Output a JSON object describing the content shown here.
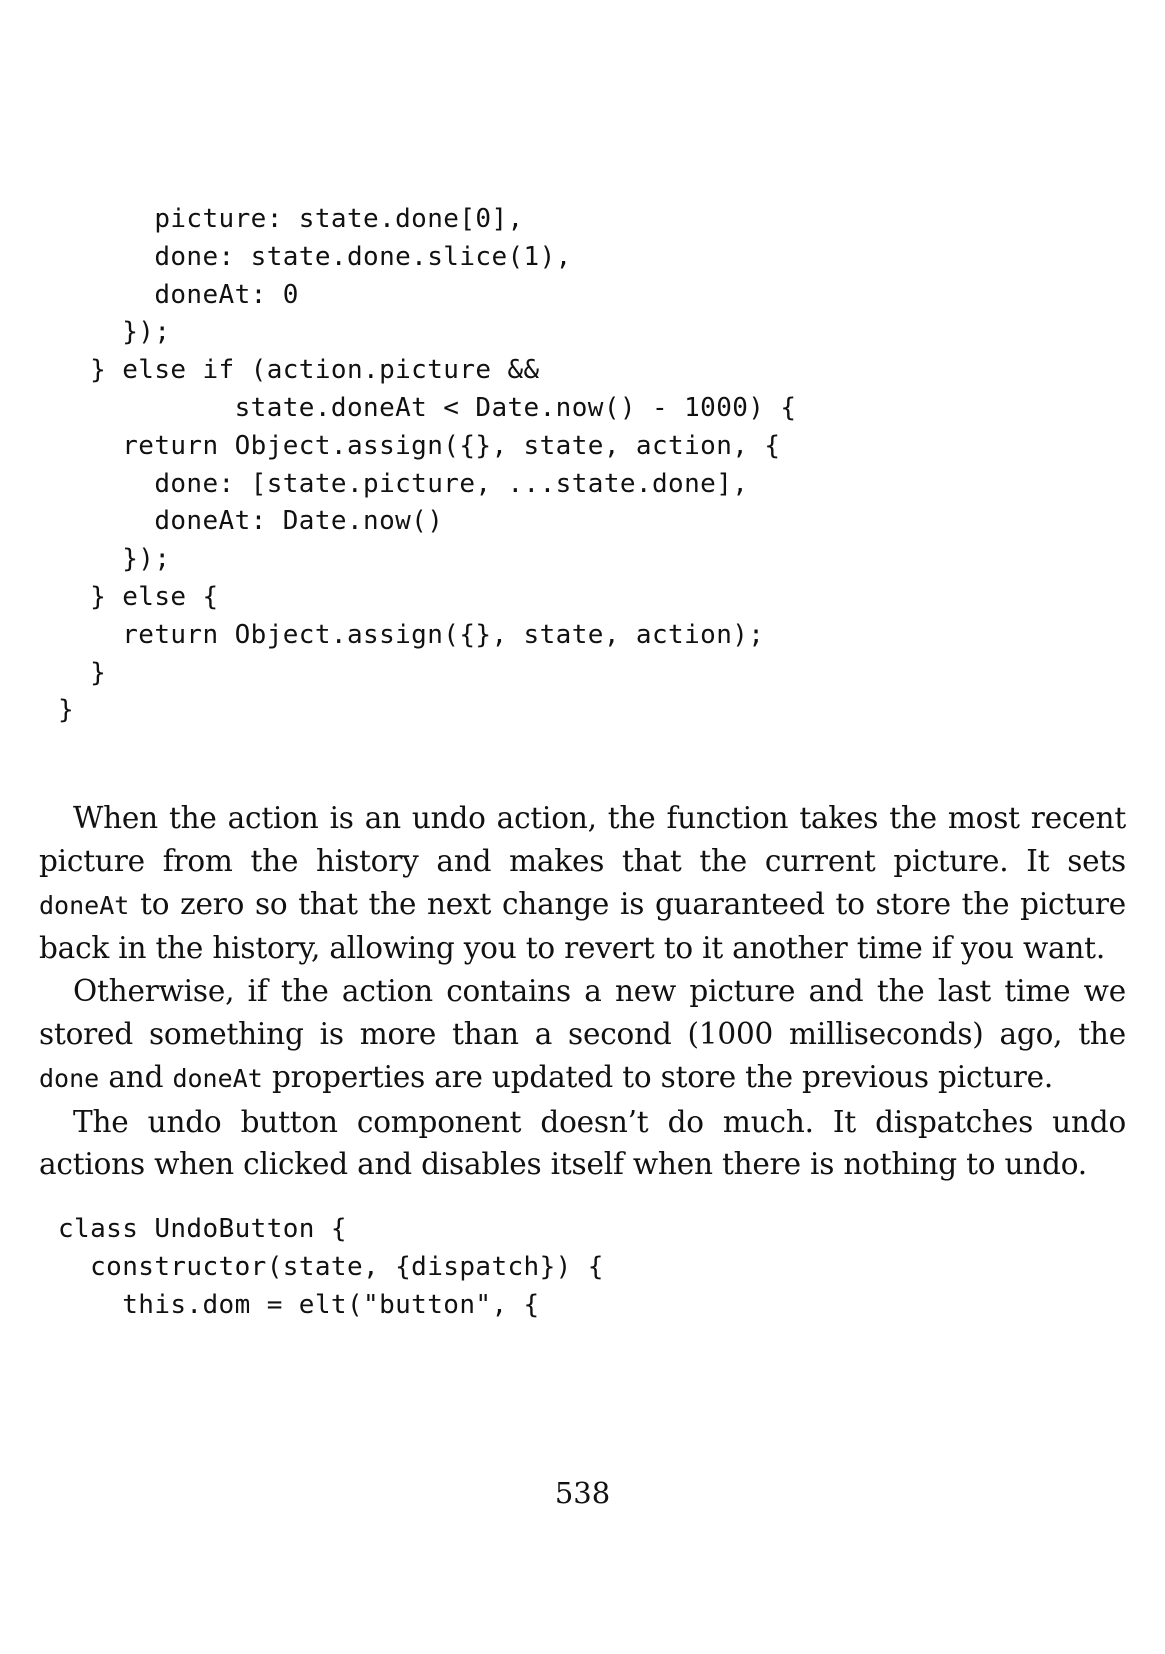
{
  "code_top": [
    {
      "indent": "      ",
      "text": "picture: state.done[0],"
    },
    {
      "indent": "      ",
      "text": "done: state.done.slice(1),"
    },
    {
      "indent": "      ",
      "text": "doneAt: 0"
    },
    {
      "indent": "    ",
      "text": "});"
    },
    {
      "indent": "  ",
      "text": "} else if (action.picture &&"
    },
    {
      "indent": "           ",
      "text": "state.doneAt < Date.now() - 1000) {"
    },
    {
      "indent": "    ",
      "text": "return Object.assign({}, state, action, {"
    },
    {
      "indent": "      ",
      "text": "done: [state.picture, ...state.done],"
    },
    {
      "indent": "      ",
      "text": "doneAt: Date.now()"
    },
    {
      "indent": "    ",
      "text": "});"
    },
    {
      "indent": "  ",
      "text": "} else {"
    },
    {
      "indent": "    ",
      "text": "return Object.assign({}, state, action);"
    },
    {
      "indent": "  ",
      "text": "}"
    },
    {
      "indent": "",
      "text": "}"
    }
  ],
  "paragraphs": {
    "p1": {
      "text_a": "When the action is an undo action, the function takes the most recent picture from the history and makes that the current picture. It sets ",
      "code_a": "doneAt",
      "text_b": " to zero so that the next change is guaranteed to store the picture back in the history, allowing you to revert to it another time if you want."
    },
    "p2": {
      "text_a": "Otherwise, if the action contains a new picture and the last time we stored something is more than a second (1000 milliseconds) ago, the ",
      "code_a": "done",
      "text_b": " and ",
      "code_b": "doneAt",
      "text_c": " properties are updated to store the previous picture."
    },
    "p3": {
      "text": "The undo button component doesn’t do much. It dispatches undo actions when clicked and disables itself when there is nothing to undo."
    }
  },
  "code_bottom": [
    {
      "indent": "",
      "text": "class UndoButton {"
    },
    {
      "indent": "  ",
      "text": "constructor(state, {dispatch}) {"
    },
    {
      "indent": "    ",
      "text": "this.dom = elt(\"button\", {"
    }
  ],
  "page_number": "538"
}
